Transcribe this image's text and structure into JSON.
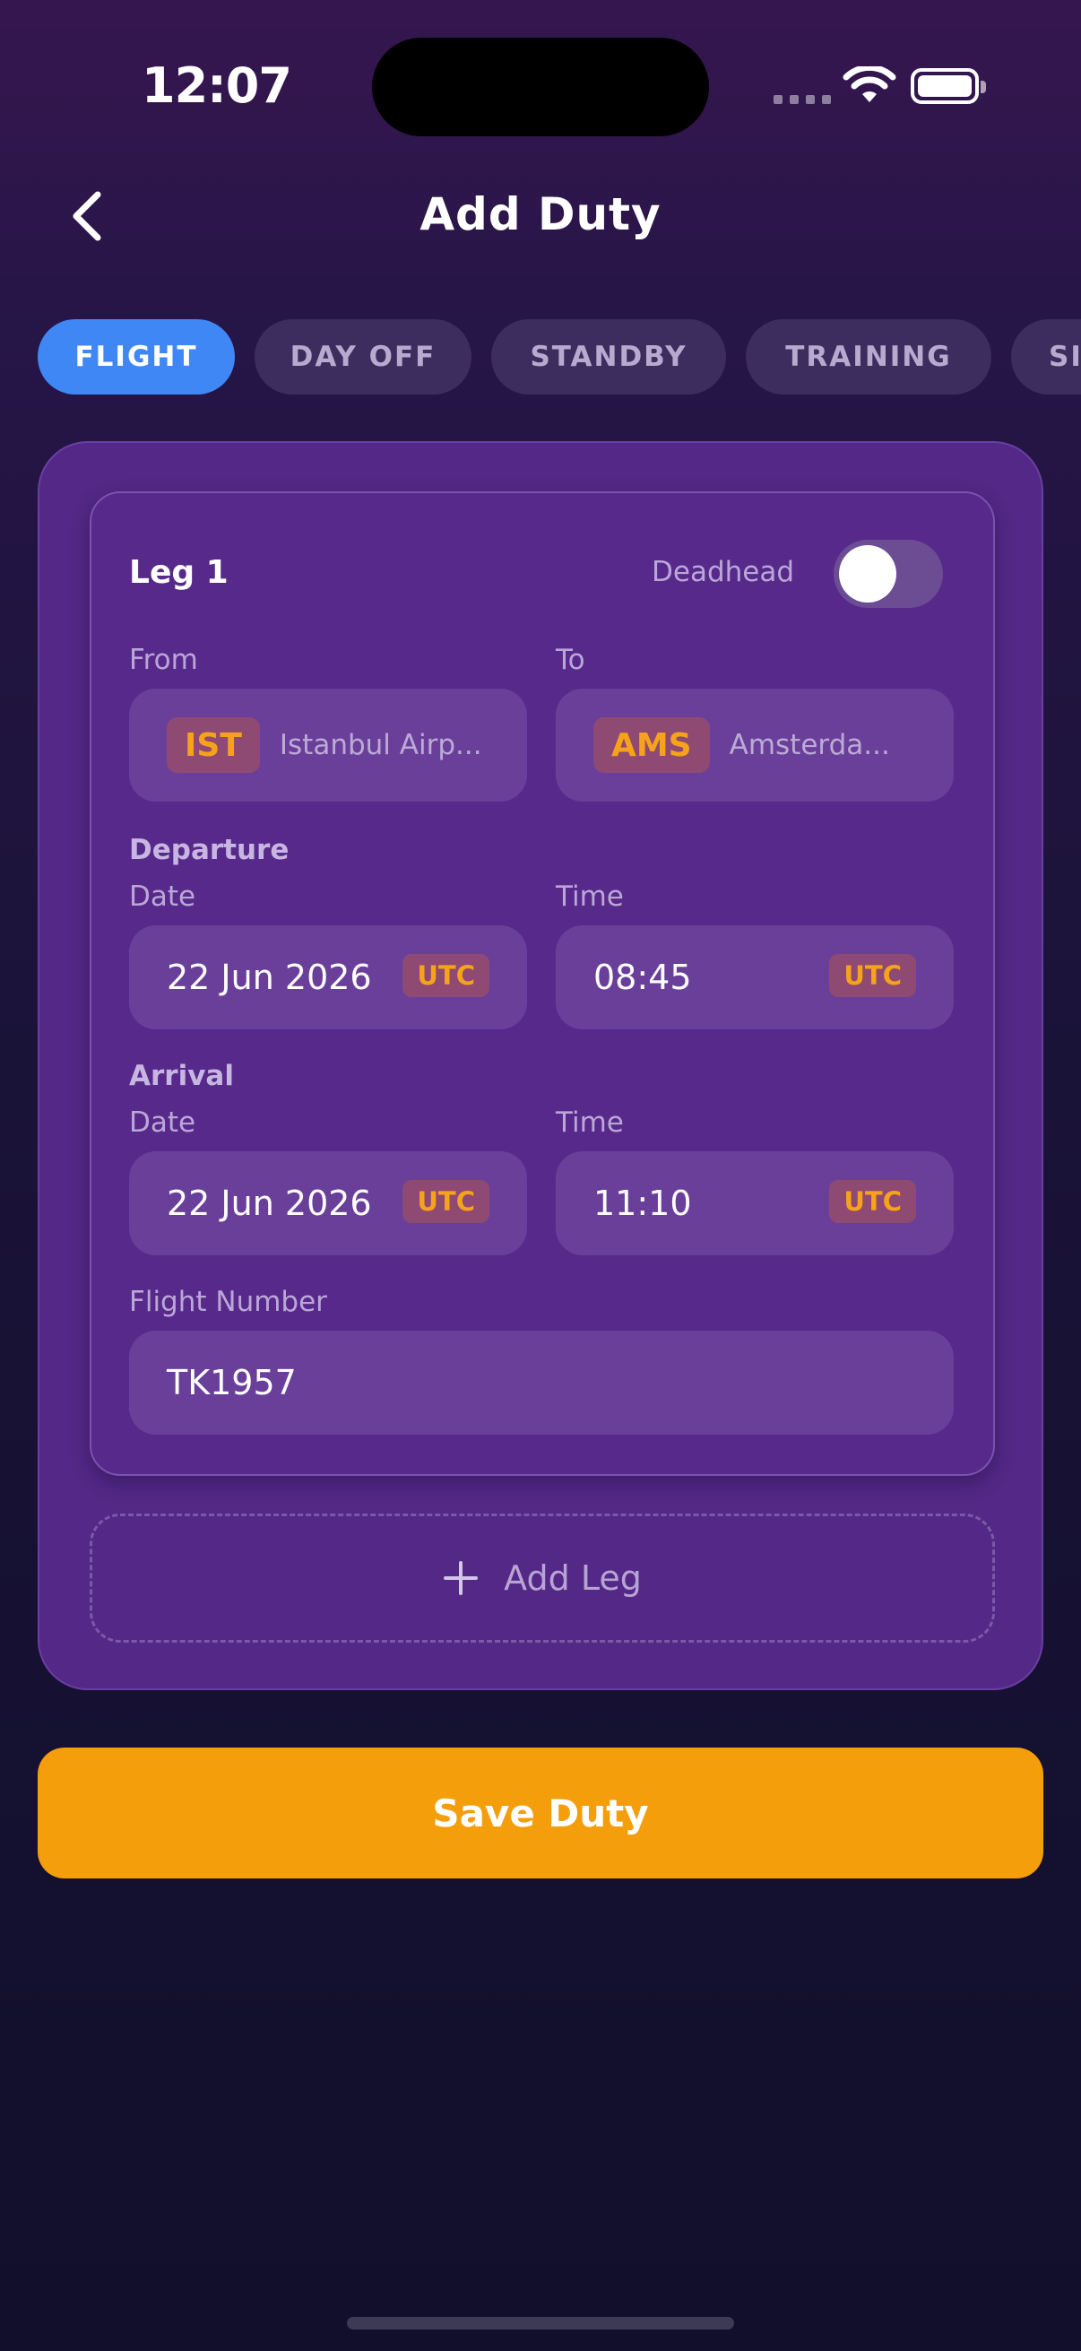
{
  "status_bar": {
    "time": "12:07"
  },
  "header": {
    "title": "Add Duty"
  },
  "duty_types": [
    {
      "label": "FLIGHT",
      "selected": true
    },
    {
      "label": "DAY OFF",
      "selected": false
    },
    {
      "label": "STANDBY",
      "selected": false
    },
    {
      "label": "TRAINING",
      "selected": false
    },
    {
      "label": "SIM",
      "selected": false
    }
  ],
  "leg": {
    "title": "Leg 1",
    "deadhead_label": "Deadhead",
    "deadhead_on": false,
    "from_label": "From",
    "from_code": "IST",
    "from_name": "Istanbul Airp...",
    "to_label": "To",
    "to_code": "AMS",
    "to_name": "Amsterda...",
    "departure": {
      "section": "Departure",
      "date_label": "Date",
      "date": "22 Jun 2026",
      "time_label": "Time",
      "time": "08:45",
      "tz": "UTC"
    },
    "arrival": {
      "section": "Arrival",
      "date_label": "Date",
      "date": "22 Jun 2026",
      "time_label": "Time",
      "time": "11:10",
      "tz": "UTC"
    },
    "flight_number_label": "Flight Number",
    "flight_number": "TK1957"
  },
  "add_leg_label": "Add Leg",
  "save_label": "Save Duty",
  "colors": {
    "accent_blue": "#3f87f5",
    "accent_orange": "#f59e0b",
    "card_purple": "#532886"
  }
}
